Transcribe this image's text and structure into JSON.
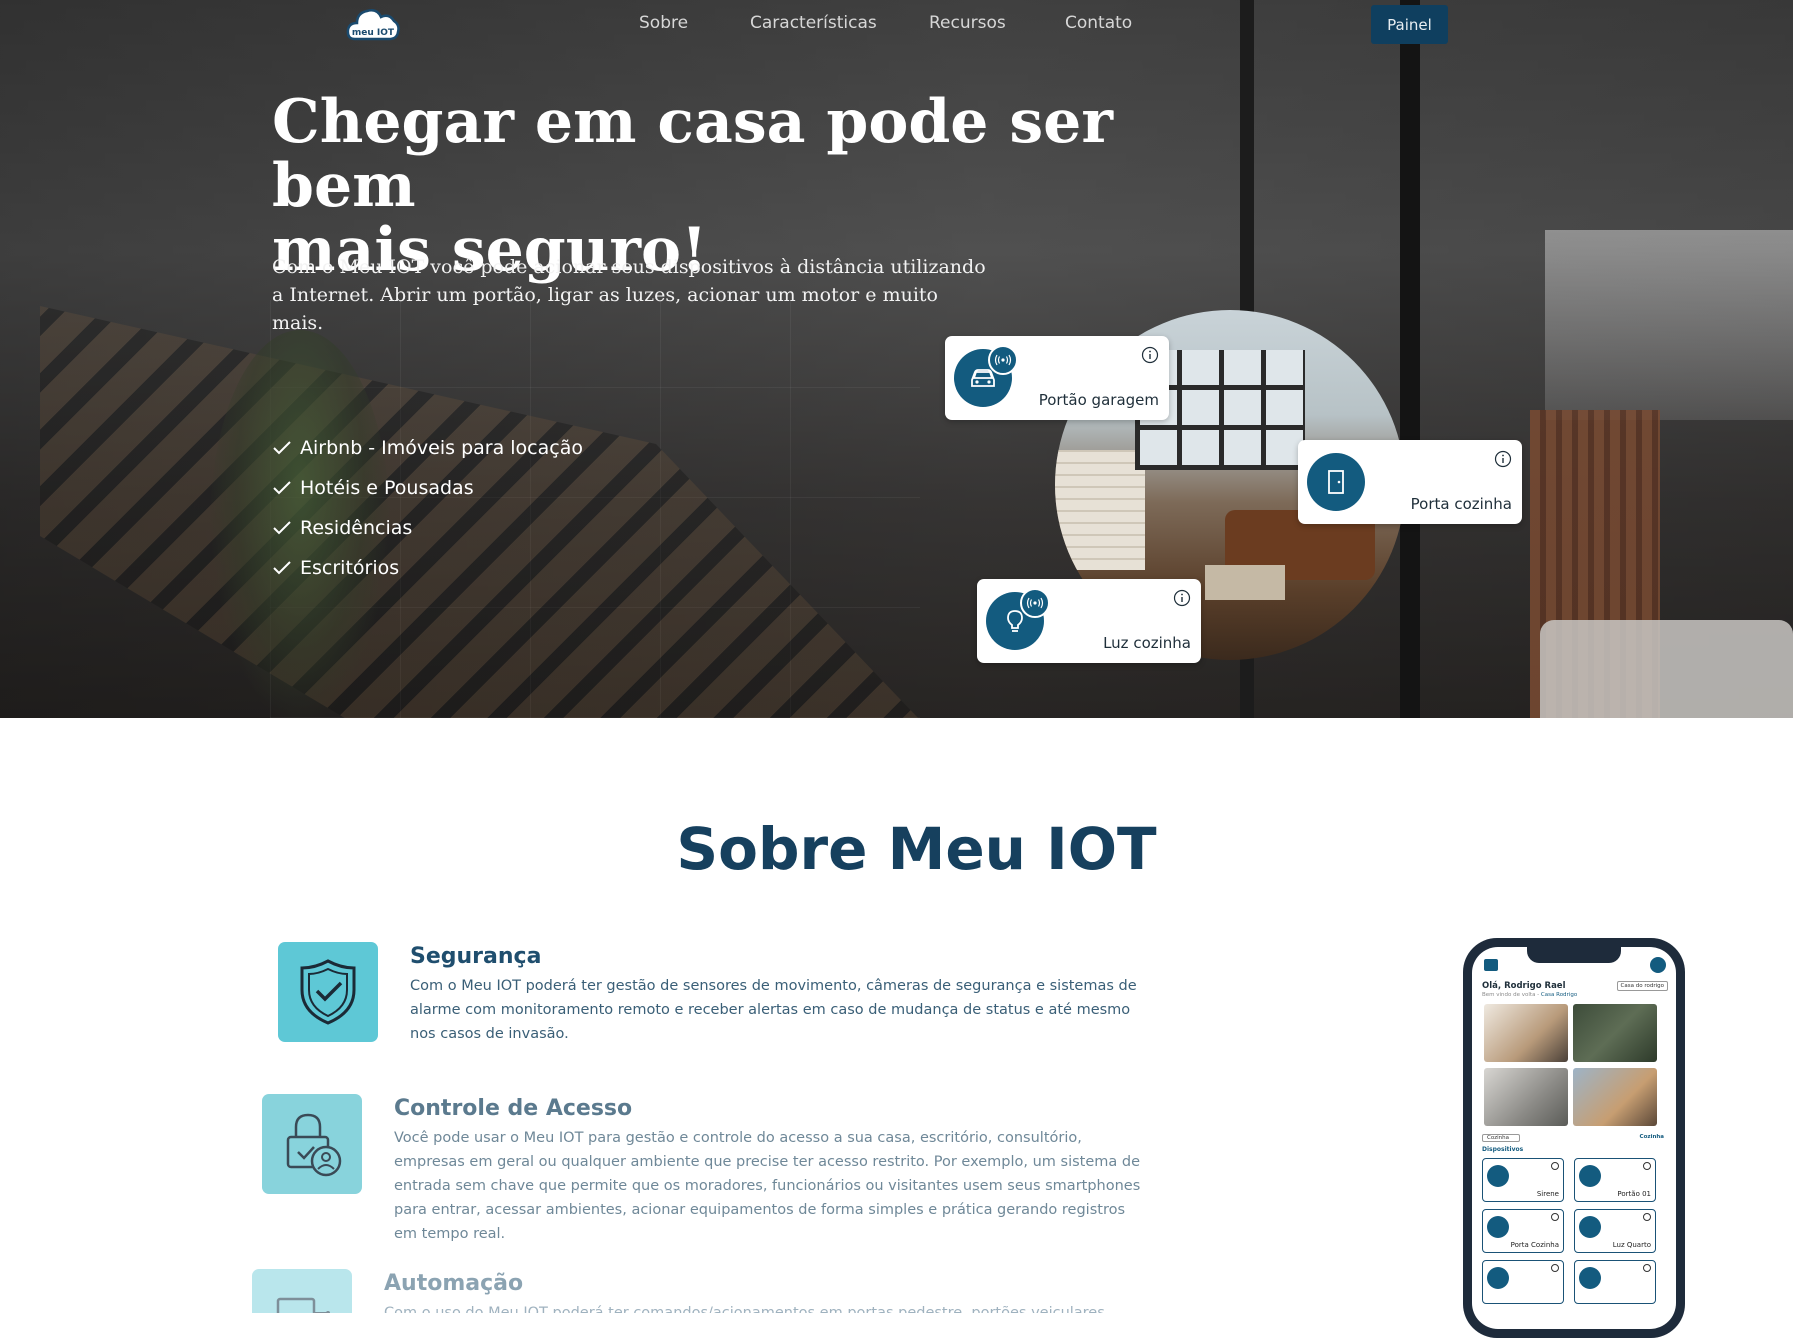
{
  "nav": {
    "logo_text": "meu IOT",
    "links": [
      "Sobre",
      "Características",
      "Recursos",
      "Contato"
    ],
    "painel_label": "Painel"
  },
  "hero": {
    "title_line1": "Chegar em casa pode ser bem",
    "title_line2": "mais seguro!",
    "description": "Com o Meu IOT você pode acionar seus dispositivos à distância utilizando a Internet. Abrir um portão, ligar as luzes, acionar um motor e muito mais.",
    "checklist": [
      "Airbnb - Imóveis para locação",
      "Hotéis e Pousadas",
      "Residências",
      "Escritórios"
    ],
    "devices": [
      {
        "label": "Portão garagem",
        "icon": "car-icon"
      },
      {
        "label": "Porta cozinha",
        "icon": "door-icon"
      },
      {
        "label": "Luz cozinha",
        "icon": "lightbulb-icon"
      }
    ]
  },
  "about": {
    "title": "Sobre Meu IOT",
    "features": [
      {
        "title": "Segurança",
        "text": "Com o Meu IOT poderá ter gestão de sensores de movimento, câmeras de segurança e sistemas de alarme com monitoramento remoto e receber alertas em caso de mudança de status e até mesmo nos casos de invasão.",
        "icon": "shield-check-icon"
      },
      {
        "title": "Controle de Acesso",
        "text": "Você pode usar o Meu IOT para gestão e controle do acesso a sua casa, escritório, consultório, empresas em geral ou qualquer ambiente que precise ter acesso restrito. Por exemplo, um sistema de entrada sem chave que permite que os moradores, funcionários ou visitantes usem seus smartphones para entrar, acessar ambientes, acionar equipamentos de forma simples e prática gerando registros em tempo real.",
        "icon": "lock-user-icon"
      },
      {
        "title": "Automação",
        "text": "Com o uso do Meu IOT poderá ter comandos/acionamentos em portas pedestre, portões veiculares",
        "icon": "automation-icon"
      }
    ]
  },
  "phone": {
    "greeting": "Olá, Rodrigo Rael",
    "subtitle_prefix": "Bem vindo de volta - ",
    "subtitle_place": "Casa Rodrigo",
    "house_select": "Casa do rodrigo",
    "room_select": "Cozinha",
    "room_link": "Cozinha",
    "section_label": "Dispositivos",
    "devices": [
      "Sirene",
      "Portão 01",
      "Porta Cozinha",
      "Luz Quarto"
    ]
  },
  "colors": {
    "brand_dark": "#16405e",
    "button": "#0f3f5f",
    "device_circle": "#135b7f",
    "feature_icon_bg": "#5ec8d6"
  }
}
